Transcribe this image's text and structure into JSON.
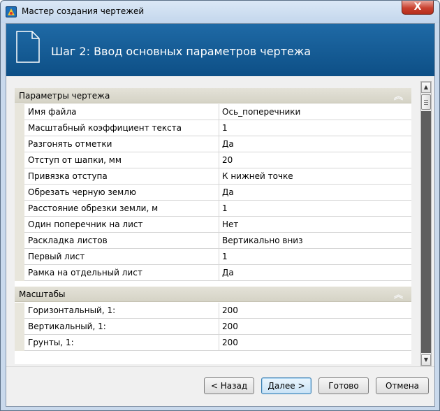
{
  "window": {
    "title": "Мастер создания чертежей",
    "close_glyph": "X"
  },
  "banner": {
    "title": "Шаг 2: Ввод основных параметров чертежа",
    "icon": "document-icon"
  },
  "groups": [
    {
      "title": "Параметры чертежа",
      "collapse_glyph": "≈",
      "rows": [
        {
          "name": "Имя файла",
          "value": "Ось_поперечники"
        },
        {
          "name": "Масштабный коэффициент текста",
          "value": "1"
        },
        {
          "name": "Разгонять отметки",
          "value": "Да"
        },
        {
          "name": "Отступ от шапки, мм",
          "value": "20"
        },
        {
          "name": "Привязка отступа",
          "value": "К нижней точке"
        },
        {
          "name": "Обрезать черную землю",
          "value": "Да"
        },
        {
          "name": "Расстояние обрезки земли, м",
          "value": "1"
        },
        {
          "name": "Один поперечник на лист",
          "value": "Нет"
        },
        {
          "name": "Раскладка листов",
          "value": "Вертикально вниз"
        },
        {
          "name": "Первый лист",
          "value": "1"
        },
        {
          "name": "Рамка на отдельный лист",
          "value": "Да"
        }
      ]
    },
    {
      "title": "Масштабы",
      "collapse_glyph": "≈",
      "rows": [
        {
          "name": "Горизонтальный, 1:",
          "value": "200"
        },
        {
          "name": "Вертикальный, 1:",
          "value": "200"
        },
        {
          "name": "Грунты, 1:",
          "value": "200"
        }
      ]
    }
  ],
  "buttons": {
    "back": "< Назад",
    "next": "Далее >",
    "finish": "Готово",
    "cancel": "Отмена"
  },
  "colors": {
    "banner": "#0d4f86",
    "group_header": "#d5d3c6",
    "close": "#c9412f"
  }
}
